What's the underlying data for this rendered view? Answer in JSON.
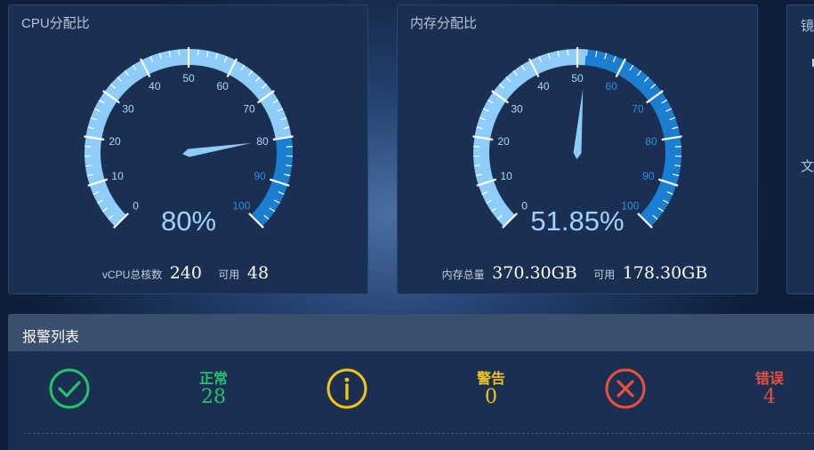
{
  "cpu": {
    "title": "CPU分配比",
    "percent": 80,
    "percent_text": "80%",
    "total_label": "vCPU总核数",
    "total_value": "240",
    "avail_label": "可用",
    "avail_value": "48"
  },
  "mem": {
    "title": "内存分配比",
    "percent": 51.85,
    "percent_text": "51.85%",
    "total_label": "内存总量",
    "total_value": "370.30GB",
    "avail_label": "可用",
    "avail_value": "178.30GB"
  },
  "gauge_scale": {
    "min": 0,
    "max": 100,
    "labels": [
      "0",
      "10",
      "20",
      "30",
      "40",
      "50",
      "60",
      "70",
      "80",
      "90",
      "100"
    ]
  },
  "mirror_panel": {
    "fragment_1": "镜",
    "fragment_2": "文"
  },
  "alarms": {
    "title": "报警列表",
    "items": [
      {
        "label": "正常",
        "count": "28",
        "icon": "check-circle-icon",
        "color": "#22c36b"
      },
      {
        "label": "警告",
        "count": "0",
        "icon": "info-circle-icon",
        "color": "#f0c419"
      },
      {
        "label": "错误",
        "count": "4",
        "icon": "x-circle-icon",
        "color": "#e8503f"
      }
    ]
  },
  "colors": {
    "gauge_light": "#8ecdf9",
    "gauge_dark": "#1a7fd0",
    "label_light": "#a8d8ff",
    "label_dark": "#2c8ee0",
    "percent_text": "#9fd3ff"
  }
}
